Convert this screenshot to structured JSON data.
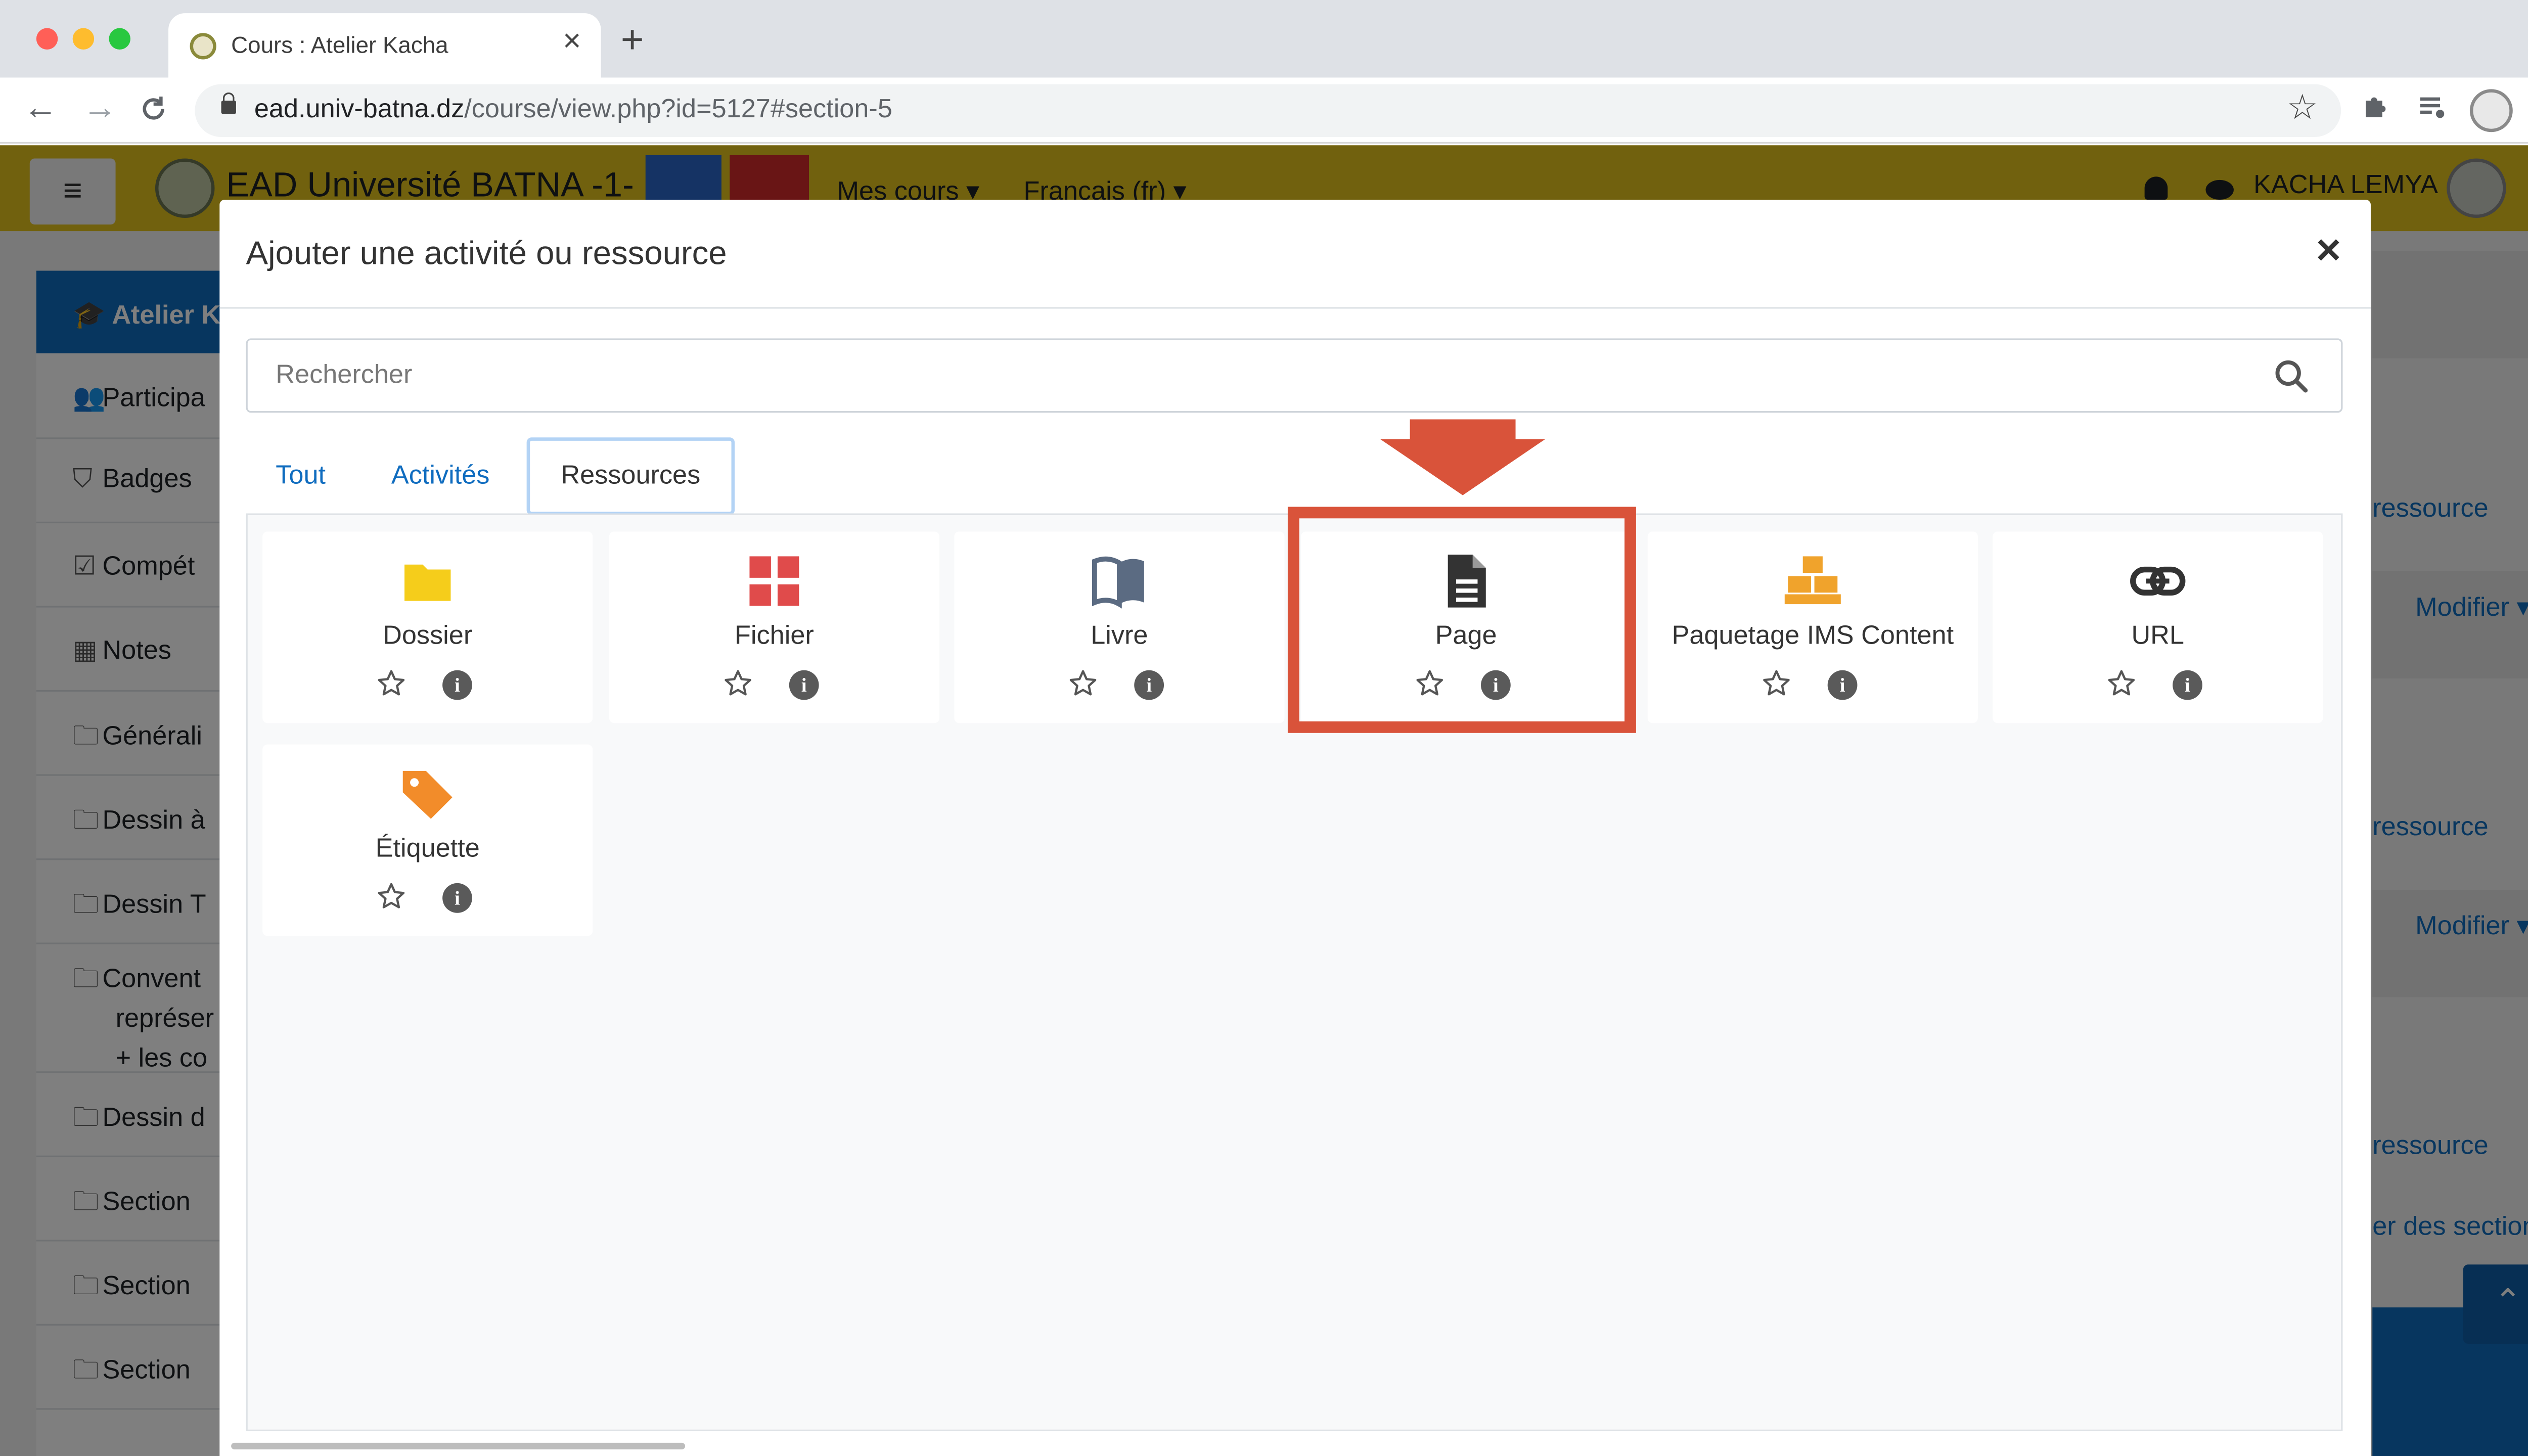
{
  "browser": {
    "tab_title": "Cours : Atelier Kacha",
    "tab_close": "×",
    "new_tab": "+",
    "url_domain": "ead.univ-batna.dz",
    "url_path": "/course/view.php?id=5127#section-5",
    "back": "←",
    "forward": "→",
    "reload": "C",
    "bookmark_star": "☆"
  },
  "navbar": {
    "menu_icon": "≡",
    "site_name": "EAD Université BATNA -1-",
    "mes_cours": "Mes cours ▾",
    "language": "Français (fr) ▾",
    "user_name": "KACHA LEMYA",
    "caret": "▾",
    "color": "#e2c21c"
  },
  "drawer": {
    "active": "Atelier K",
    "items": [
      {
        "icon": "users-icon",
        "glyph": "👥",
        "label": "Participa"
      },
      {
        "icon": "shield-icon",
        "glyph": "⛉",
        "label": "Badges"
      },
      {
        "icon": "check-square-icon",
        "glyph": "☑",
        "label": "Compét"
      },
      {
        "icon": "table-icon",
        "glyph": "▦",
        "label": "Notes"
      },
      {
        "icon": "folder-icon",
        "glyph": "🗀",
        "label": "Générali"
      },
      {
        "icon": "folder-icon",
        "glyph": "🗀",
        "label": "Dessin à"
      },
      {
        "icon": "folder-icon",
        "glyph": "🗀",
        "label": "Dessin T"
      },
      {
        "icon": "folder-icon",
        "glyph": "🗀",
        "label": "Convent"
      },
      {
        "icon": "folder-icon",
        "glyph": "🗀",
        "label": "Dessin d"
      },
      {
        "icon": "folder-icon",
        "glyph": "🗀",
        "label": "Section"
      },
      {
        "icon": "folder-icon",
        "glyph": "🗀",
        "label": "Section"
      },
      {
        "icon": "folder-icon",
        "glyph": "🗀",
        "label": "Section"
      }
    ],
    "convent_line2": "représer",
    "convent_line3": "+ les co"
  },
  "background": {
    "modifier": "Modifier ▾",
    "ressource": "ressource",
    "sections_link": "er des sections",
    "back_to_top": "⌃"
  },
  "modal": {
    "title": "Ajouter une activité ou ressource",
    "close": "×",
    "search_placeholder": "Rechercher",
    "tabs": {
      "all": "Tout",
      "activities": "Activités",
      "resources": "Ressources"
    },
    "cards": [
      {
        "label": "Dossier",
        "icon": "folder-icon",
        "info": "i"
      },
      {
        "label": "Fichier",
        "icon": "file-icon",
        "info": "i"
      },
      {
        "label": "Livre",
        "icon": "book-icon",
        "info": "i"
      },
      {
        "label": "Page",
        "icon": "page-icon",
        "info": "i",
        "highlighted": true
      },
      {
        "label": "Paquetage IMS Content",
        "icon": "package-icon",
        "info": "i"
      },
      {
        "label": "URL",
        "icon": "link-icon",
        "info": "i"
      },
      {
        "label": "Étiquette",
        "icon": "tag-icon",
        "info": "i"
      }
    ]
  },
  "colors": {
    "accent_blue": "#0f6cbf",
    "highlight": "#d9533a",
    "folder": "#f5cd1b",
    "file": "#e04b4b",
    "book": "#5b6b82",
    "package": "#f0a32c",
    "tag": "#f28c2a"
  }
}
